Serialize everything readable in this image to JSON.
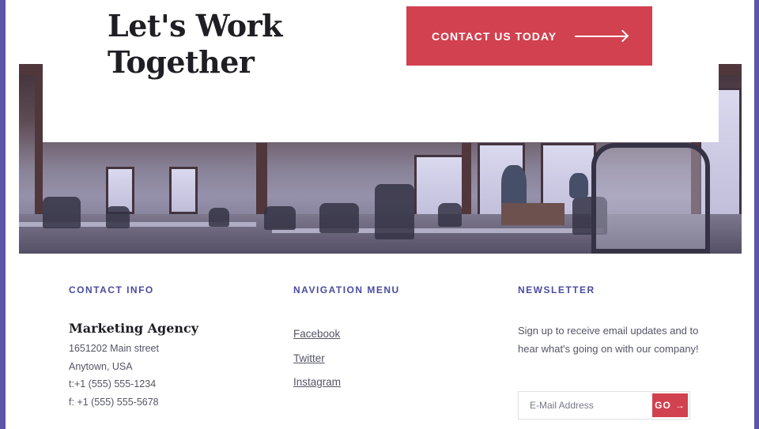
{
  "cta": {
    "headline": "Let's Work Together",
    "button_label": "CONTACT US TODAY",
    "button_icon": "arrow-right-icon"
  },
  "footer": {
    "contact": {
      "title": "CONTACT INFO",
      "company": "Marketing Agency",
      "address_line1": "1651202 Main street",
      "address_line2": "Anytown, USA",
      "phone": "t:+1 (555) 555-1234",
      "fax": "f: +1 (555) 555-5678"
    },
    "navigation": {
      "title": "NAVIGATION MENU",
      "links": [
        "Facebook",
        "Twitter",
        "Instagram"
      ]
    },
    "newsletter": {
      "title": "NEWSLETTER",
      "description": "Sign up to receive email updates and to hear what's going on with our company!",
      "email_placeholder": "E-Mail Address",
      "button_label": "GO",
      "button_icon": "→"
    }
  },
  "colors": {
    "accent": "#d2414f",
    "heading_blue": "#4b4ba0",
    "frame": "#5b56a8"
  }
}
